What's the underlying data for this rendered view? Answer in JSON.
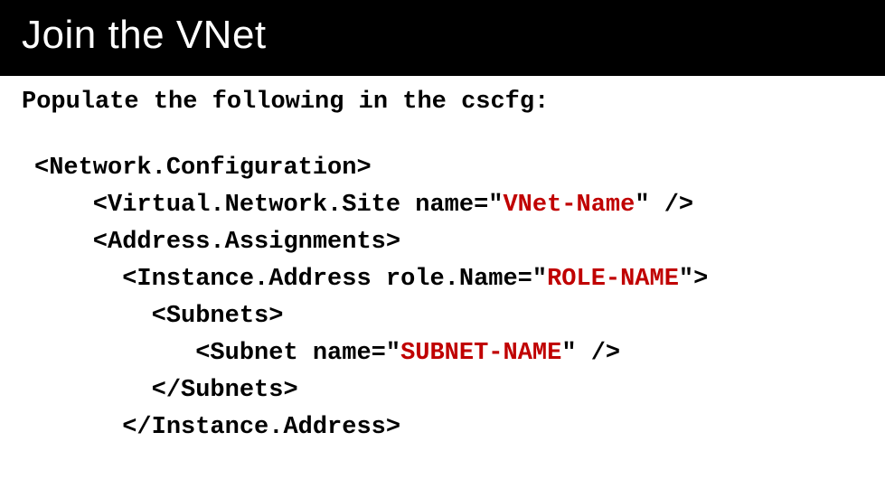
{
  "title": "Join the VNet",
  "intro": "Populate the following in the cscfg:",
  "code": {
    "l1": "<Network.Configuration>",
    "l2a": "    <Virtual.Network.Site name=\"",
    "l2b": "VNet-Name",
    "l2c": "\" />",
    "l3": "    <Address.Assignments>",
    "l4a": "      <Instance.Address role.Name=\"",
    "l4b": "ROLE-NAME",
    "l4c": "\">",
    "l5": "        <Subnets>",
    "l6a": "           <Subnet name=\"",
    "l6b": "SUBNET-NAME",
    "l6c": "\" />",
    "l7": "        </Subnets>",
    "l8": "      </Instance.Address>"
  }
}
